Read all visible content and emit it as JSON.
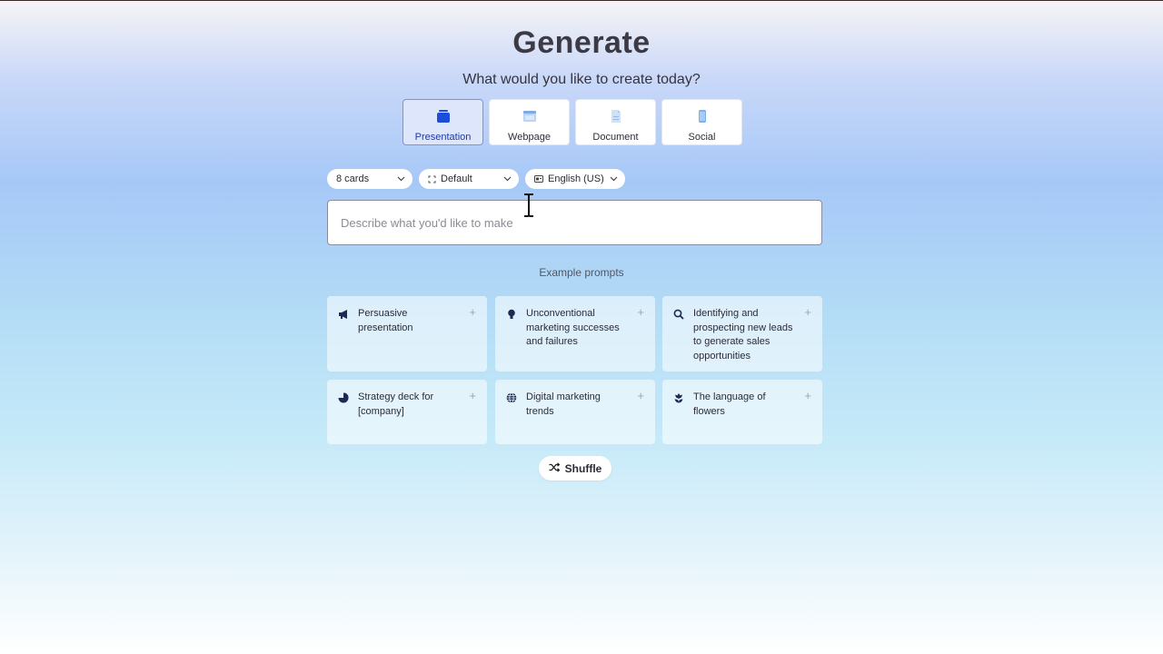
{
  "header": {
    "title": "Generate",
    "subtitle": "What would you like to create today?"
  },
  "types": [
    {
      "label": "Presentation",
      "icon": "presentation-icon",
      "selected": true
    },
    {
      "label": "Webpage",
      "icon": "webpage-icon",
      "selected": false
    },
    {
      "label": "Document",
      "icon": "document-icon",
      "selected": false
    },
    {
      "label": "Social",
      "icon": "social-icon",
      "selected": false
    }
  ],
  "controls": {
    "cards": "8 cards",
    "theme": "Default",
    "language": "English (US)"
  },
  "prompt": {
    "placeholder": "Describe what you'd like to make",
    "value": ""
  },
  "examples": {
    "heading": "Example prompts",
    "items": [
      {
        "text": "Persuasive presentation",
        "icon": "megaphone-icon"
      },
      {
        "text": "Unconventional marketing successes and failures",
        "icon": "lightbulb-icon"
      },
      {
        "text": "Identifying and prospecting new leads to generate sales opportunities",
        "icon": "search-icon"
      },
      {
        "text": "Strategy deck for [company]",
        "icon": "pie-chart-icon"
      },
      {
        "text": "Digital marketing trends",
        "icon": "globe-icon"
      },
      {
        "text": "The language of flowers",
        "icon": "flower-icon"
      }
    ],
    "add_symbol": "+"
  },
  "shuffle": {
    "label": "Shuffle"
  },
  "colors": {
    "accent": "#1f3aa3",
    "active_tab_bg": "#dde6fb",
    "icon_blue": "#1d4ed8",
    "icon_light_blue": "#8fb8f0",
    "text": "#2d2b3a"
  }
}
